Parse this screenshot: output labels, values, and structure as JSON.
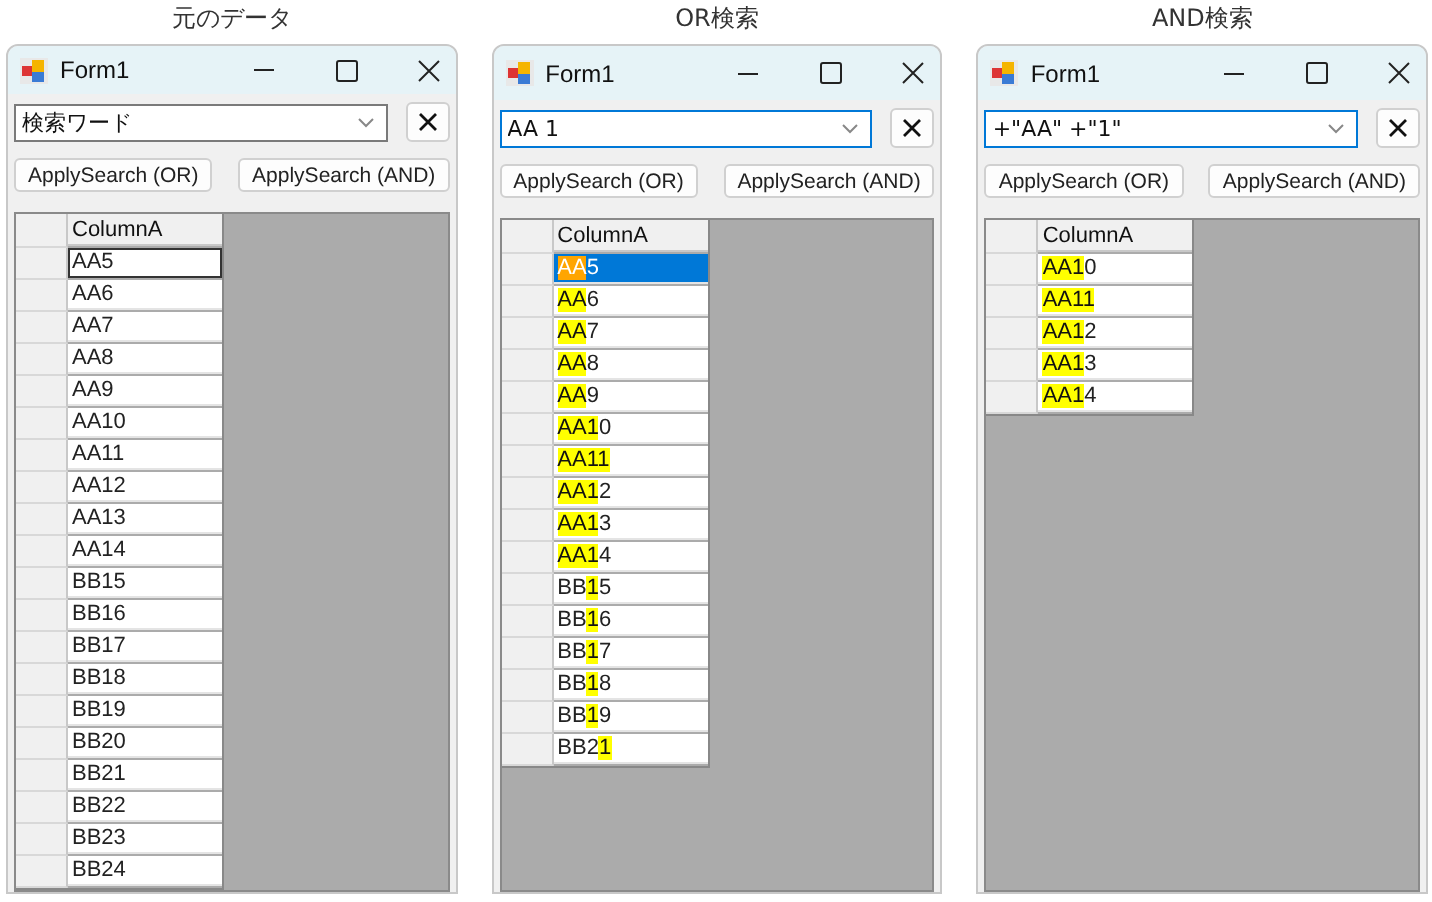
{
  "panels": [
    {
      "caption": "元のデータ",
      "window": {
        "title": "Form1",
        "search": {
          "value": "検索ワード",
          "focused": false
        },
        "buttons": [
          "ApplySearch (OR)",
          "ApplySearch (AND)"
        ],
        "column": "ColumnA",
        "rows": [
          {
            "selected": false,
            "focused": true,
            "parts": [
              {
                "text": "AA5",
                "highlighted": false
              }
            ]
          },
          {
            "selected": false,
            "focused": false,
            "parts": [
              {
                "text": "AA6",
                "highlighted": false
              }
            ]
          },
          {
            "selected": false,
            "focused": false,
            "parts": [
              {
                "text": "AA7",
                "highlighted": false
              }
            ]
          },
          {
            "selected": false,
            "focused": false,
            "parts": [
              {
                "text": "AA8",
                "highlighted": false
              }
            ]
          },
          {
            "selected": false,
            "focused": false,
            "parts": [
              {
                "text": "AA9",
                "highlighted": false
              }
            ]
          },
          {
            "selected": false,
            "focused": false,
            "parts": [
              {
                "text": "AA10",
                "highlighted": false
              }
            ]
          },
          {
            "selected": false,
            "focused": false,
            "parts": [
              {
                "text": "AA11",
                "highlighted": false
              }
            ]
          },
          {
            "selected": false,
            "focused": false,
            "parts": [
              {
                "text": "AA12",
                "highlighted": false
              }
            ]
          },
          {
            "selected": false,
            "focused": false,
            "parts": [
              {
                "text": "AA13",
                "highlighted": false
              }
            ]
          },
          {
            "selected": false,
            "focused": false,
            "parts": [
              {
                "text": "AA14",
                "highlighted": false
              }
            ]
          },
          {
            "selected": false,
            "focused": false,
            "parts": [
              {
                "text": "BB15",
                "highlighted": false
              }
            ]
          },
          {
            "selected": false,
            "focused": false,
            "parts": [
              {
                "text": "BB16",
                "highlighted": false
              }
            ]
          },
          {
            "selected": false,
            "focused": false,
            "parts": [
              {
                "text": "BB17",
                "highlighted": false
              }
            ]
          },
          {
            "selected": false,
            "focused": false,
            "parts": [
              {
                "text": "BB18",
                "highlighted": false
              }
            ]
          },
          {
            "selected": false,
            "focused": false,
            "parts": [
              {
                "text": "BB19",
                "highlighted": false
              }
            ]
          },
          {
            "selected": false,
            "focused": false,
            "parts": [
              {
                "text": "BB20",
                "highlighted": false
              }
            ]
          },
          {
            "selected": false,
            "focused": false,
            "parts": [
              {
                "text": "BB21",
                "highlighted": false
              }
            ]
          },
          {
            "selected": false,
            "focused": false,
            "parts": [
              {
                "text": "BB22",
                "highlighted": false
              }
            ]
          },
          {
            "selected": false,
            "focused": false,
            "parts": [
              {
                "text": "BB23",
                "highlighted": false
              }
            ]
          },
          {
            "selected": false,
            "focused": false,
            "parts": [
              {
                "text": "BB24",
                "highlighted": false
              }
            ]
          }
        ]
      }
    },
    {
      "caption": "OR検索",
      "window": {
        "title": "Form1",
        "search": {
          "value": "AA 1",
          "focused": true
        },
        "buttons": [
          "ApplySearch (OR)",
          "ApplySearch (AND)"
        ],
        "column": "ColumnA",
        "rows": [
          {
            "selected": true,
            "focused": false,
            "parts": [
              {
                "text": "AA",
                "highlighted": true
              },
              {
                "text": "5",
                "highlighted": false
              }
            ]
          },
          {
            "selected": false,
            "focused": false,
            "parts": [
              {
                "text": "AA",
                "highlighted": true
              },
              {
                "text": "6",
                "highlighted": false
              }
            ]
          },
          {
            "selected": false,
            "focused": false,
            "parts": [
              {
                "text": "AA",
                "highlighted": true
              },
              {
                "text": "7",
                "highlighted": false
              }
            ]
          },
          {
            "selected": false,
            "focused": false,
            "parts": [
              {
                "text": "AA",
                "highlighted": true
              },
              {
                "text": "8",
                "highlighted": false
              }
            ]
          },
          {
            "selected": false,
            "focused": false,
            "parts": [
              {
                "text": "AA",
                "highlighted": true
              },
              {
                "text": "9",
                "highlighted": false
              }
            ]
          },
          {
            "selected": false,
            "focused": false,
            "parts": [
              {
                "text": "AA1",
                "highlighted": true
              },
              {
                "text": "0",
                "highlighted": false
              }
            ]
          },
          {
            "selected": false,
            "focused": false,
            "parts": [
              {
                "text": "AA11",
                "highlighted": true
              }
            ]
          },
          {
            "selected": false,
            "focused": false,
            "parts": [
              {
                "text": "AA1",
                "highlighted": true
              },
              {
                "text": "2",
                "highlighted": false
              }
            ]
          },
          {
            "selected": false,
            "focused": false,
            "parts": [
              {
                "text": "AA1",
                "highlighted": true
              },
              {
                "text": "3",
                "highlighted": false
              }
            ]
          },
          {
            "selected": false,
            "focused": false,
            "parts": [
              {
                "text": "AA1",
                "highlighted": true
              },
              {
                "text": "4",
                "highlighted": false
              }
            ]
          },
          {
            "selected": false,
            "focused": false,
            "parts": [
              {
                "text": "BB",
                "highlighted": false
              },
              {
                "text": "1",
                "highlighted": true
              },
              {
                "text": "5",
                "highlighted": false
              }
            ]
          },
          {
            "selected": false,
            "focused": false,
            "parts": [
              {
                "text": "BB",
                "highlighted": false
              },
              {
                "text": "1",
                "highlighted": true
              },
              {
                "text": "6",
                "highlighted": false
              }
            ]
          },
          {
            "selected": false,
            "focused": false,
            "parts": [
              {
                "text": "BB",
                "highlighted": false
              },
              {
                "text": "1",
                "highlighted": true
              },
              {
                "text": "7",
                "highlighted": false
              }
            ]
          },
          {
            "selected": false,
            "focused": false,
            "parts": [
              {
                "text": "BB",
                "highlighted": false
              },
              {
                "text": "1",
                "highlighted": true
              },
              {
                "text": "8",
                "highlighted": false
              }
            ]
          },
          {
            "selected": false,
            "focused": false,
            "parts": [
              {
                "text": "BB",
                "highlighted": false
              },
              {
                "text": "1",
                "highlighted": true
              },
              {
                "text": "9",
                "highlighted": false
              }
            ]
          },
          {
            "selected": false,
            "focused": false,
            "parts": [
              {
                "text": "BB2",
                "highlighted": false
              },
              {
                "text": "1",
                "highlighted": true
              }
            ]
          }
        ]
      }
    },
    {
      "caption": "AND検索",
      "window": {
        "title": "Form1",
        "search": {
          "value": "+\"AA\" +\"1\"",
          "focused": true
        },
        "buttons": [
          "ApplySearch (OR)",
          "ApplySearch (AND)"
        ],
        "column": "ColumnA",
        "rows": [
          {
            "selected": false,
            "focused": false,
            "parts": [
              {
                "text": "AA1",
                "highlighted": true
              },
              {
                "text": "0",
                "highlighted": false
              }
            ]
          },
          {
            "selected": false,
            "focused": false,
            "parts": [
              {
                "text": "AA11",
                "highlighted": true
              }
            ]
          },
          {
            "selected": false,
            "focused": false,
            "parts": [
              {
                "text": "AA1",
                "highlighted": true
              },
              {
                "text": "2",
                "highlighted": false
              }
            ]
          },
          {
            "selected": false,
            "focused": false,
            "parts": [
              {
                "text": "AA1",
                "highlighted": true
              },
              {
                "text": "3",
                "highlighted": false
              }
            ]
          },
          {
            "selected": false,
            "focused": false,
            "parts": [
              {
                "text": "AA1",
                "highlighted": true
              },
              {
                "text": "4",
                "highlighted": false
              }
            ]
          }
        ]
      }
    }
  ]
}
